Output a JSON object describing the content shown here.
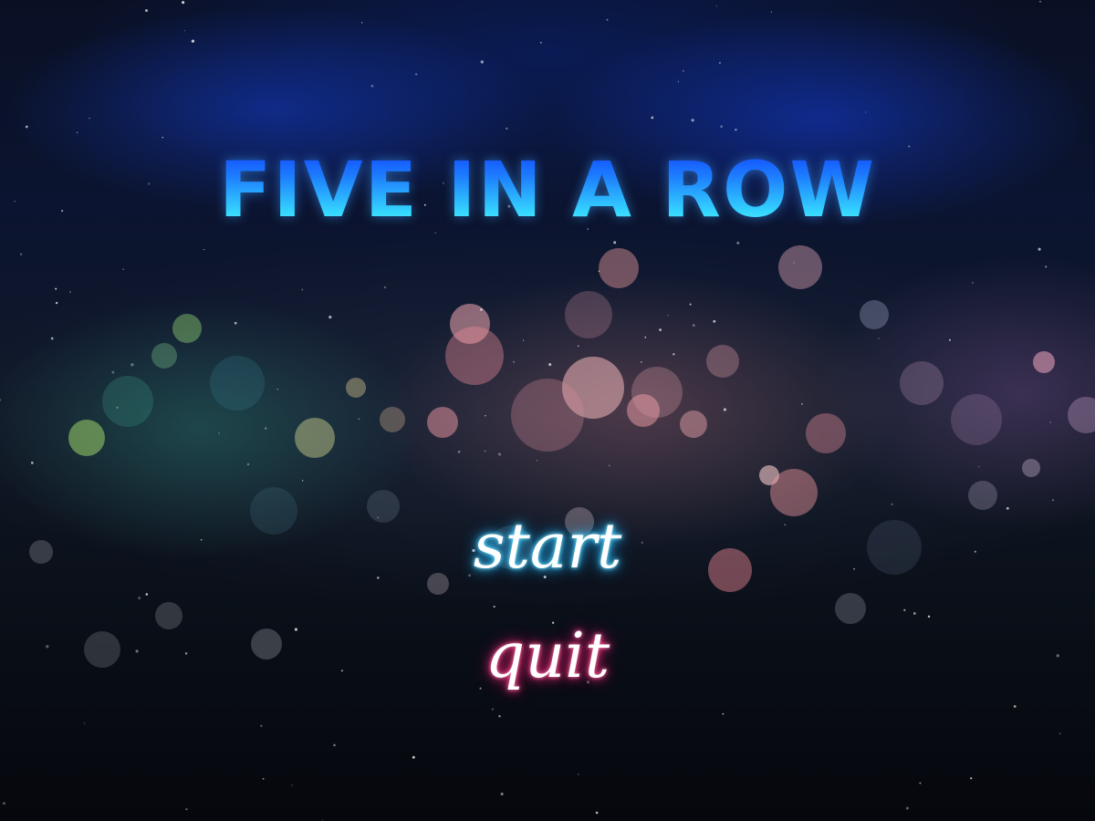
{
  "game": {
    "title": "FIVE IN A ROW",
    "menu": {
      "start_label": "start",
      "quit_label": "quit"
    }
  },
  "colors": {
    "title_gradient_top": "#0f3cff",
    "title_gradient_bottom": "#7bf4ff",
    "start_glow": "#2fc8ff",
    "quit_glow": "#ff2f7a",
    "background": "#05080f"
  }
}
